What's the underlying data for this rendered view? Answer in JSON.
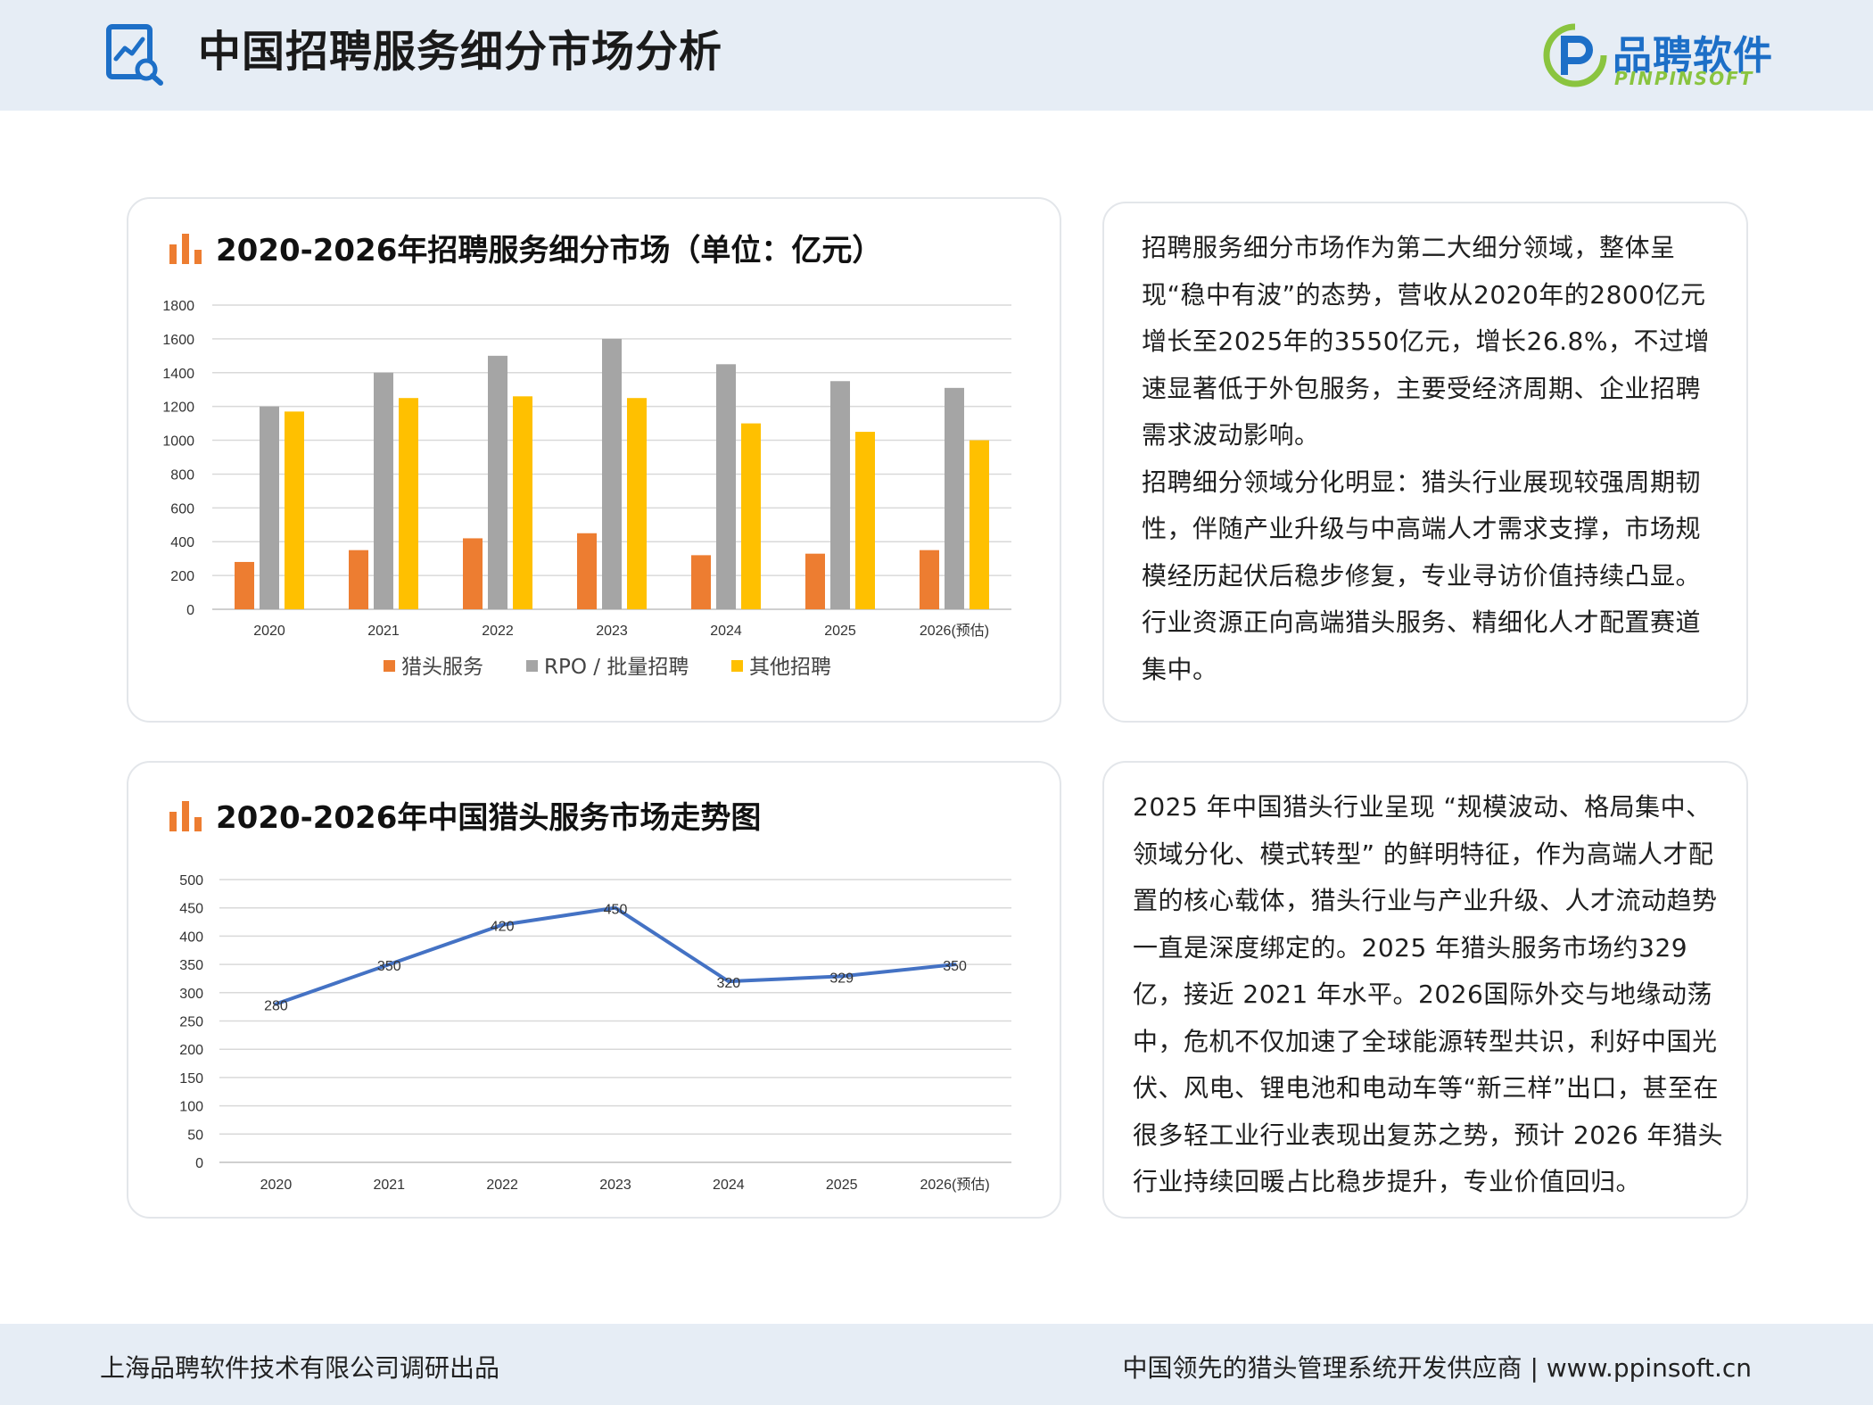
{
  "header": {
    "title": "中国招聘服务细分市场分析",
    "logo_cn": "品聘软件",
    "logo_en": "PINPINSOFT",
    "icon": "chart-search-icon"
  },
  "colors": {
    "accent": "#ed7d31",
    "gray": "#a5a5a5",
    "yellow": "#ffc000",
    "line": "#4472c4",
    "brand_blue": "#1d6fc7",
    "brand_green": "#8ac43f"
  },
  "chart1": {
    "title": "2020-2026年招聘服务细分市场（单位：亿元）"
  },
  "chart2": {
    "title": "2020-2026年中国猎头服务市场走势图"
  },
  "chart_data": [
    {
      "type": "bar",
      "categories": [
        "2020",
        "2021",
        "2022",
        "2023",
        "2024",
        "2025",
        "2026(预估)"
      ],
      "series": [
        {
          "name": "猎头服务",
          "color": "#ed7d31",
          "values": [
            280,
            350,
            420,
            450,
            320,
            329,
            350
          ]
        },
        {
          "name": "RPO / 批量招聘",
          "color": "#a5a5a5",
          "values": [
            1200,
            1400,
            1500,
            1600,
            1450,
            1350,
            1310
          ]
        },
        {
          "name": "其他招聘",
          "color": "#ffc000",
          "values": [
            1170,
            1250,
            1260,
            1250,
            1100,
            1050,
            1000
          ]
        }
      ],
      "ylim": [
        0,
        1800
      ],
      "yticks": [
        0,
        200,
        400,
        600,
        800,
        1000,
        1200,
        1400,
        1600,
        1800
      ],
      "grid": true,
      "legend": "bottom"
    },
    {
      "type": "line",
      "categories": [
        "2020",
        "2021",
        "2022",
        "2023",
        "2024",
        "2025",
        "2026(预估)"
      ],
      "series": [
        {
          "color": "#4472c4",
          "values": [
            280,
            350,
            420,
            450,
            320,
            329,
            350
          ]
        }
      ],
      "data_labels": [
        "280",
        "350",
        "420",
        "450",
        "320",
        "329",
        "350"
      ],
      "ylim": [
        0,
        500
      ],
      "yticks": [
        0,
        50,
        100,
        150,
        200,
        250,
        300,
        350,
        400,
        450,
        500
      ],
      "grid": true
    }
  ],
  "text1": {
    "p1": "招聘服务细分市场作为第二大细分领域，整体呈现“稳中有波”的态势，营收从2020年的2800亿元增长至2025年的3550亿元，增长26.8%，不过增速显著低于外包服务，主要受经济周期、企业招聘需求波动影响。",
    "p2": "招聘细分领域分化明显：猎头行业展现较强周期韧性，伴随产业升级与中高端人才需求支撑，市场规模经历起伏后稳步修复，专业寻访价值持续凸显。行业资源正向高端猎头服务、精细化人才配置赛道集中。"
  },
  "text2": {
    "p1": "2025 年中国猎头行业呈现 “规模波动、格局集中、领域分化、模式转型” 的鲜明特征，作为高端人才配置的核心载体，猎头行业与产业升级、人才流动趋势一直是深度绑定的。2025 年猎头服务市场约329亿，接近 2021 年水平。2026国际外交与地缘动荡中，危机不仅加速了全球能源转型共识，利好中国光伏、风电、锂电池和电动车等“新三样”出口，甚至在很多轻工业行业表现出复苏之势，预计 2026 年猎头行业持续回暖占比稳步提升，专业价值回归。"
  },
  "footer": {
    "left": "上海品聘软件技术有限公司调研出品",
    "right": "中国领先的猎头管理系统开发供应商 |  www.ppinsoft.cn"
  }
}
